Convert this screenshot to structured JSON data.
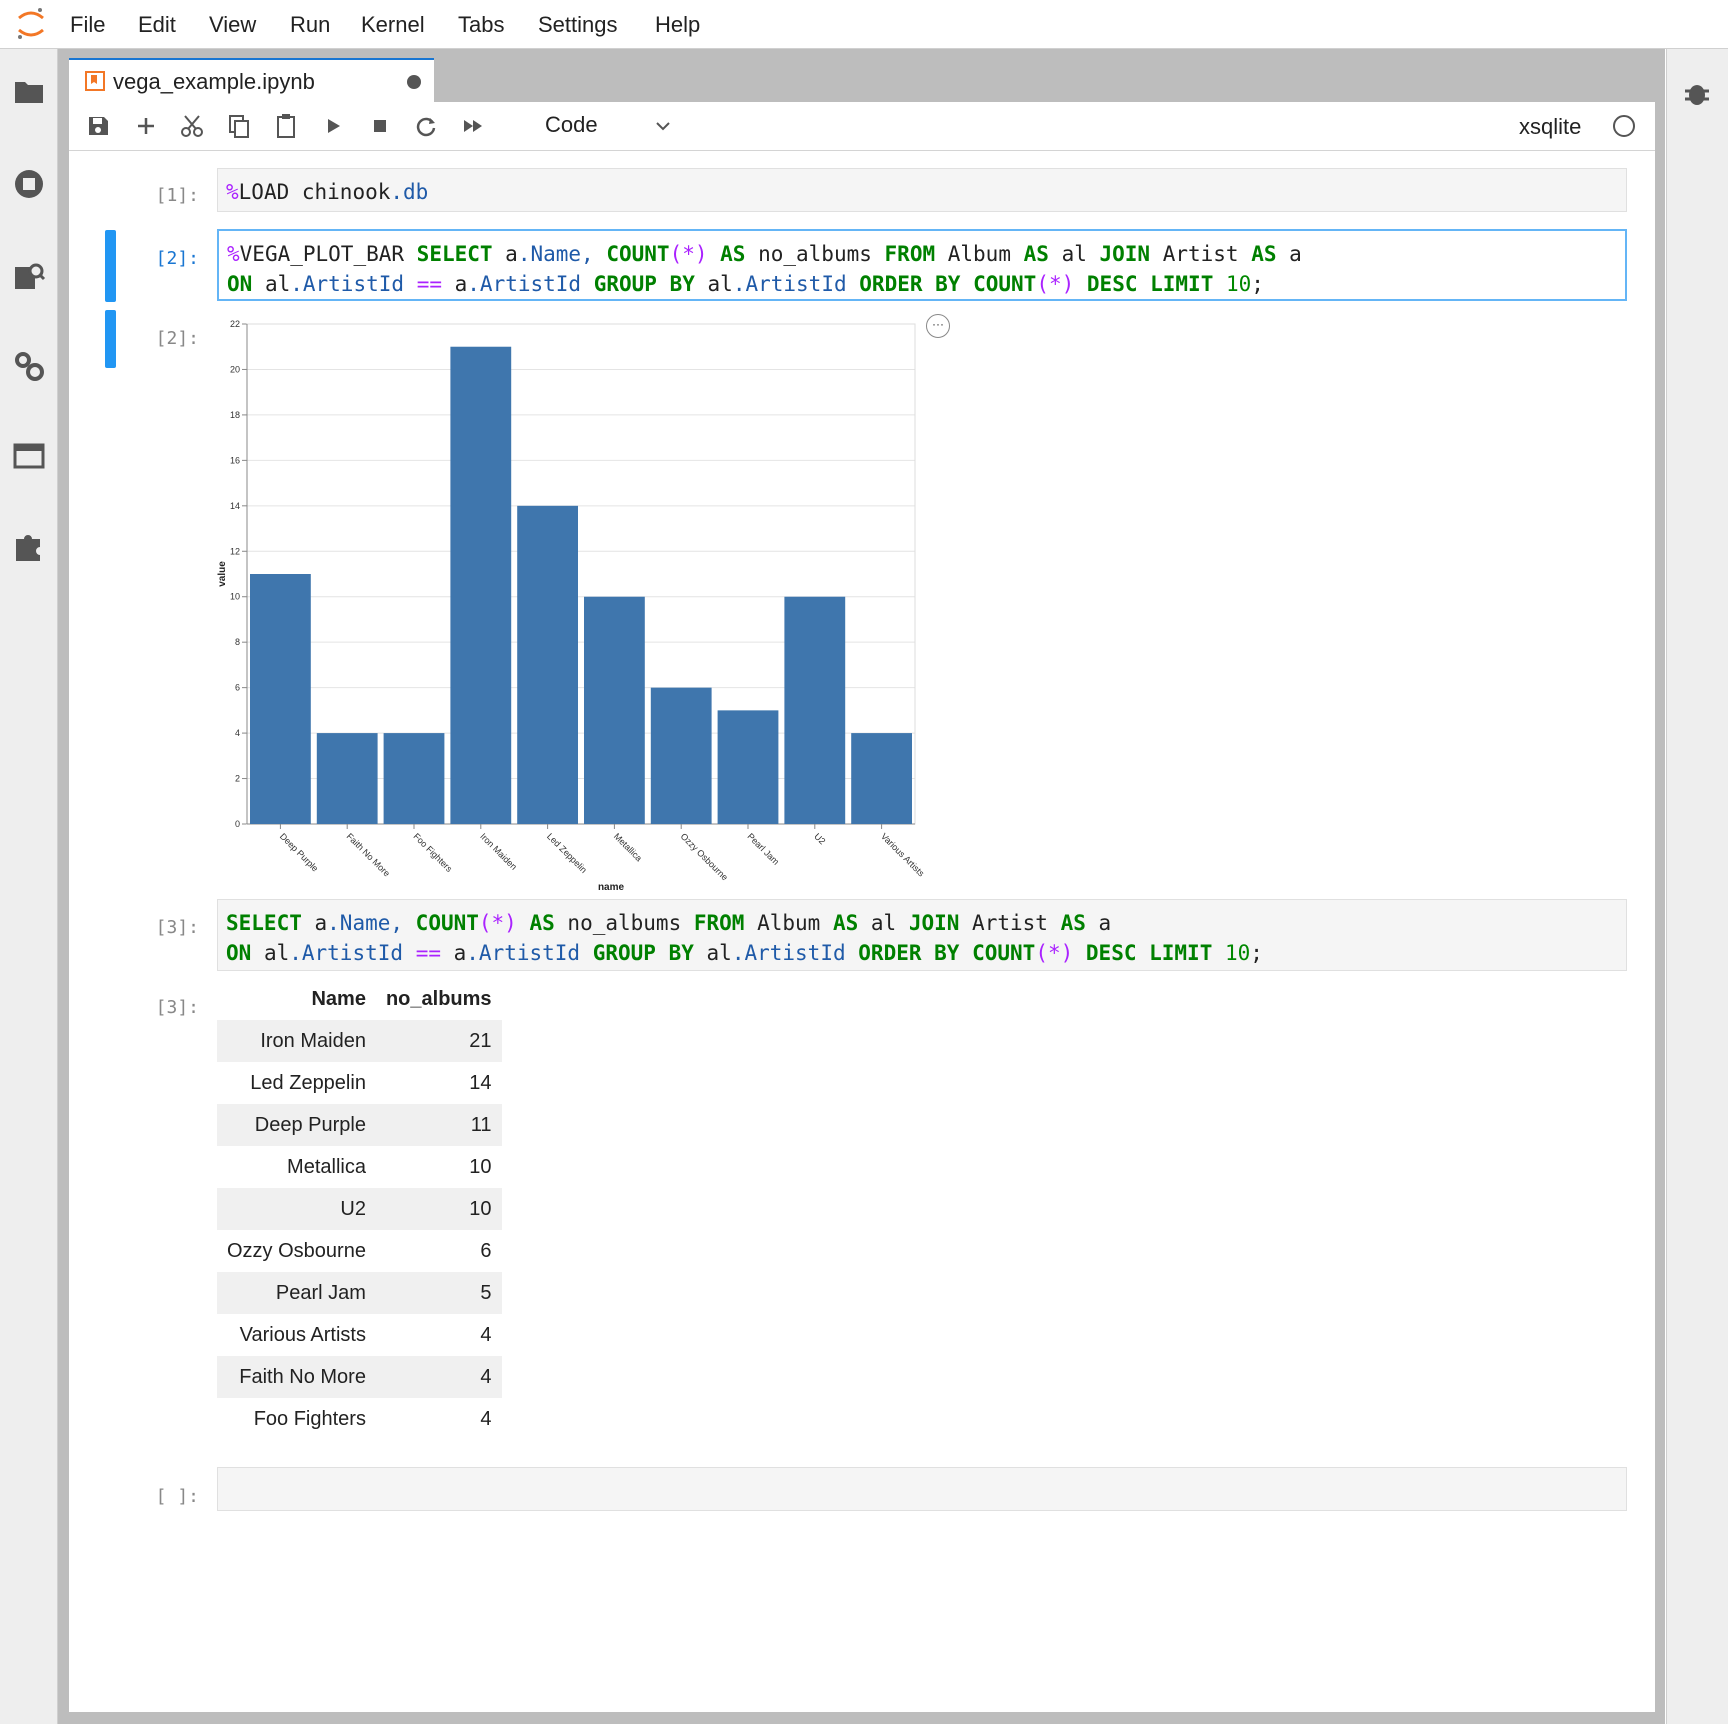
{
  "menubar": {
    "items": [
      "File",
      "Edit",
      "View",
      "Run",
      "Kernel",
      "Tabs",
      "Settings",
      "Help"
    ]
  },
  "tab": {
    "title": "vega_example.ipynb"
  },
  "toolbar": {
    "cell_type": "Code",
    "kernel_name": "xsqlite"
  },
  "cells": [
    {
      "prompt": "[1]:",
      "kind": "code",
      "lines": [
        "%LOAD chinook.db"
      ]
    },
    {
      "prompt": "[2]:",
      "kind": "code",
      "lines": [
        "%VEGA_PLOT_BAR SELECT a.Name, COUNT(*) AS no_albums FROM Album AS al JOIN Artist AS a",
        "ON al.ArtistId == a.ArtistId GROUP BY al.ArtistId ORDER BY COUNT(*) DESC LIMIT 10;"
      ]
    },
    {
      "prompt": "[2]:",
      "kind": "output-chart"
    },
    {
      "prompt": "[3]:",
      "kind": "code",
      "lines": [
        "SELECT a.Name, COUNT(*) AS no_albums FROM Album AS al JOIN Artist AS a",
        "ON al.ArtistId == a.ArtistId GROUP BY al.ArtistId ORDER BY COUNT(*) DESC LIMIT 10;"
      ]
    },
    {
      "prompt": "[3]:",
      "kind": "output-table"
    },
    {
      "prompt": "[ ]:",
      "kind": "code",
      "lines": []
    }
  ],
  "chart_data": {
    "type": "bar",
    "categories": [
      "Deep Purple",
      "Faith No More",
      "Foo Fighters",
      "Iron Maiden",
      "Led Zeppelin",
      "Metallica",
      "Ozzy Osbourne",
      "Pearl Jam",
      "U2",
      "Various Artists"
    ],
    "values": [
      11,
      4,
      4,
      21,
      14,
      10,
      6,
      5,
      10,
      4
    ],
    "xlabel": "name",
    "ylabel": "value",
    "ylim": [
      0,
      22
    ],
    "yticks": [
      0,
      2,
      4,
      6,
      8,
      10,
      12,
      14,
      16,
      18,
      20,
      22
    ],
    "bar_color": "#3f76ad",
    "grid": true
  },
  "table": {
    "headers": [
      "Name",
      "no_albums"
    ],
    "rows": [
      [
        "Iron Maiden",
        "21"
      ],
      [
        "Led Zeppelin",
        "14"
      ],
      [
        "Deep Purple",
        "11"
      ],
      [
        "Metallica",
        "10"
      ],
      [
        "U2",
        "10"
      ],
      [
        "Ozzy Osbourne",
        "6"
      ],
      [
        "Pearl Jam",
        "5"
      ],
      [
        "Various Artists",
        "4"
      ],
      [
        "Faith No More",
        "4"
      ],
      [
        "Foo Fighters",
        "4"
      ]
    ]
  },
  "colors": {
    "accent": "#2196f3",
    "logo": "#f37726"
  }
}
